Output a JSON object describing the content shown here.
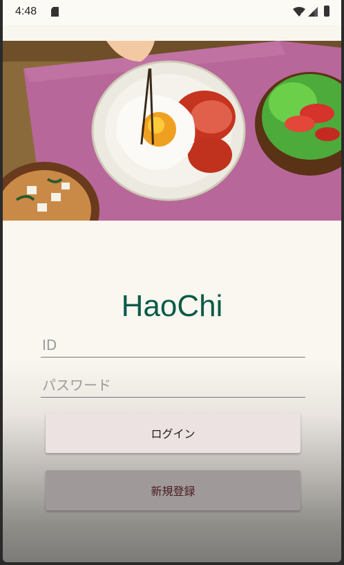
{
  "status_bar": {
    "time": "4:48"
  },
  "app": {
    "title": "HaoChi"
  },
  "login_form": {
    "id_placeholder": "ID",
    "password_placeholder": "パスワード",
    "login_label": "ログイン",
    "register_label": "新規登録"
  },
  "colors": {
    "title": "#0b5a4a",
    "background": "#f9f7ef"
  }
}
